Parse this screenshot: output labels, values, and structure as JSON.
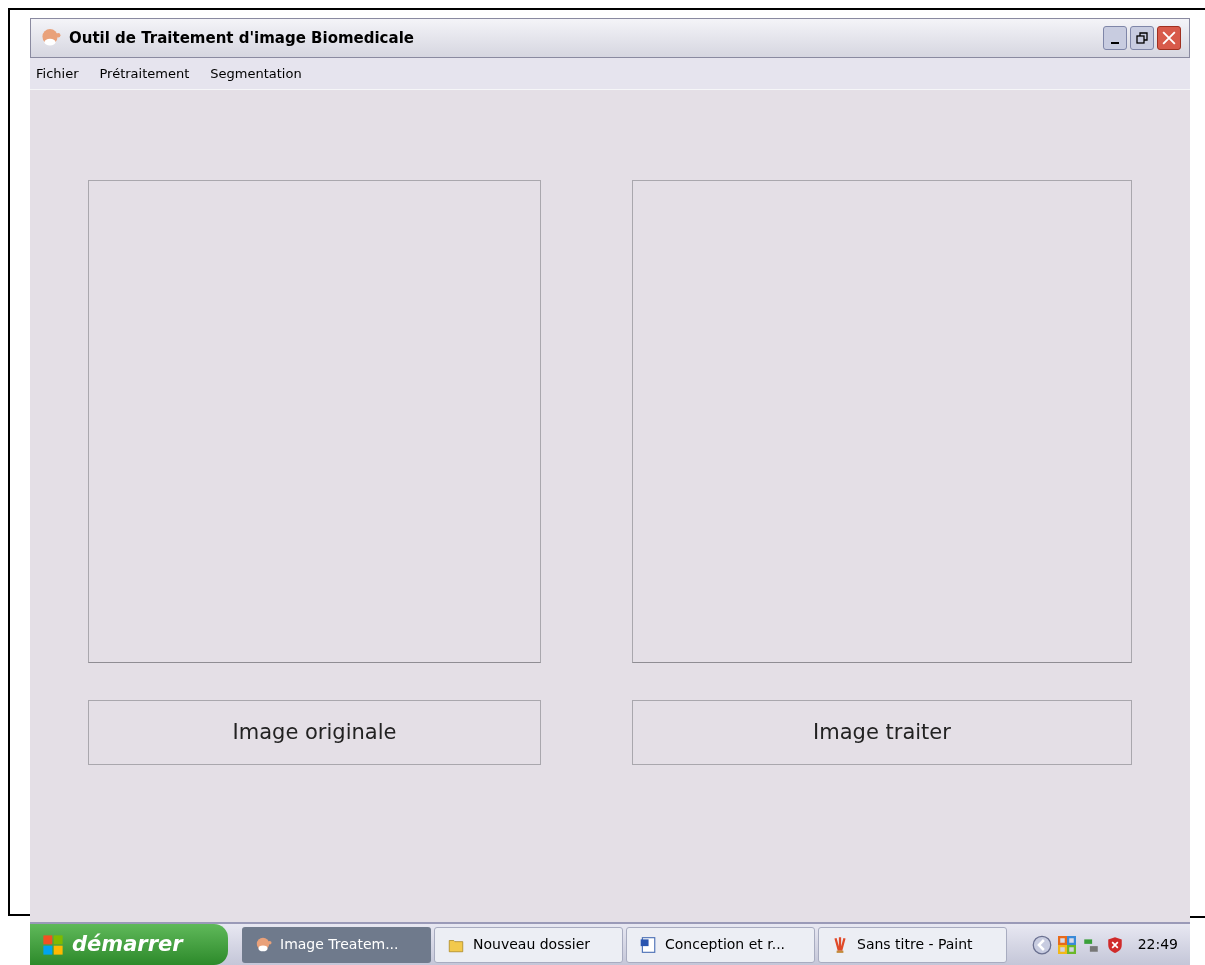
{
  "window": {
    "title": "Outil de Traitement d'image Biomedicale"
  },
  "menu": [
    "Fichier",
    "Prétraitement",
    "Segmentation"
  ],
  "panels": [
    {
      "caption": "Image originale"
    },
    {
      "caption": "Image traiter"
    }
  ],
  "taskbar": {
    "start": "démarrer",
    "tasks": [
      {
        "label": "Image Treatem...",
        "kind": "app",
        "selected": true
      },
      {
        "label": "Nouveau dossier",
        "kind": "folder",
        "selected": false
      },
      {
        "label": "Conception et r...",
        "kind": "word",
        "selected": false
      },
      {
        "label": "Sans titre - Paint",
        "kind": "paint",
        "selected": false
      }
    ],
    "clock": "22:49"
  }
}
